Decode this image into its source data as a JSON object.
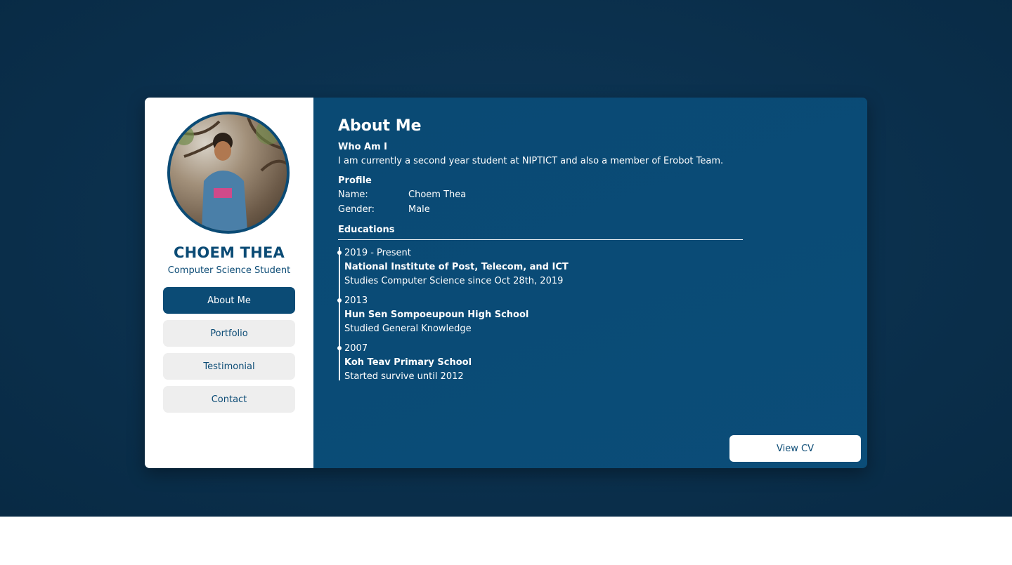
{
  "sidebar": {
    "name": "CHOEM THEA",
    "role": "Computer Science Student",
    "nav": [
      {
        "label": "About Me"
      },
      {
        "label": "Portfolio"
      },
      {
        "label": "Testimonial"
      },
      {
        "label": "Contact"
      }
    ]
  },
  "main": {
    "title": "About Me",
    "who_heading": "Who Am I",
    "who_text": "I am currently a second year student at NIPTICT and also a member of Erobot Team.",
    "profile_heading": "Profile",
    "profile": [
      {
        "label": "Name:",
        "value": "Choem Thea"
      },
      {
        "label": "Gender:",
        "value": "Male"
      }
    ],
    "education_heading": "Educations",
    "education": [
      {
        "years": "2019 - Present",
        "school": "National Institute of Post, Telecom, and ICT",
        "detail": "Studies Computer Science since Oct 28th, 2019"
      },
      {
        "years": "2013",
        "school": "Hun Sen Sompoeupoun High School",
        "detail": "Studied General Knowledge"
      },
      {
        "years": "2007",
        "school": "Koh Teav Primary School",
        "detail": "Started survive until 2012"
      }
    ],
    "cv_button": "View CV"
  },
  "colors": {
    "primary": "#0b4b75",
    "background": "#0b304d",
    "nav_inactive": "#eeeeee"
  }
}
